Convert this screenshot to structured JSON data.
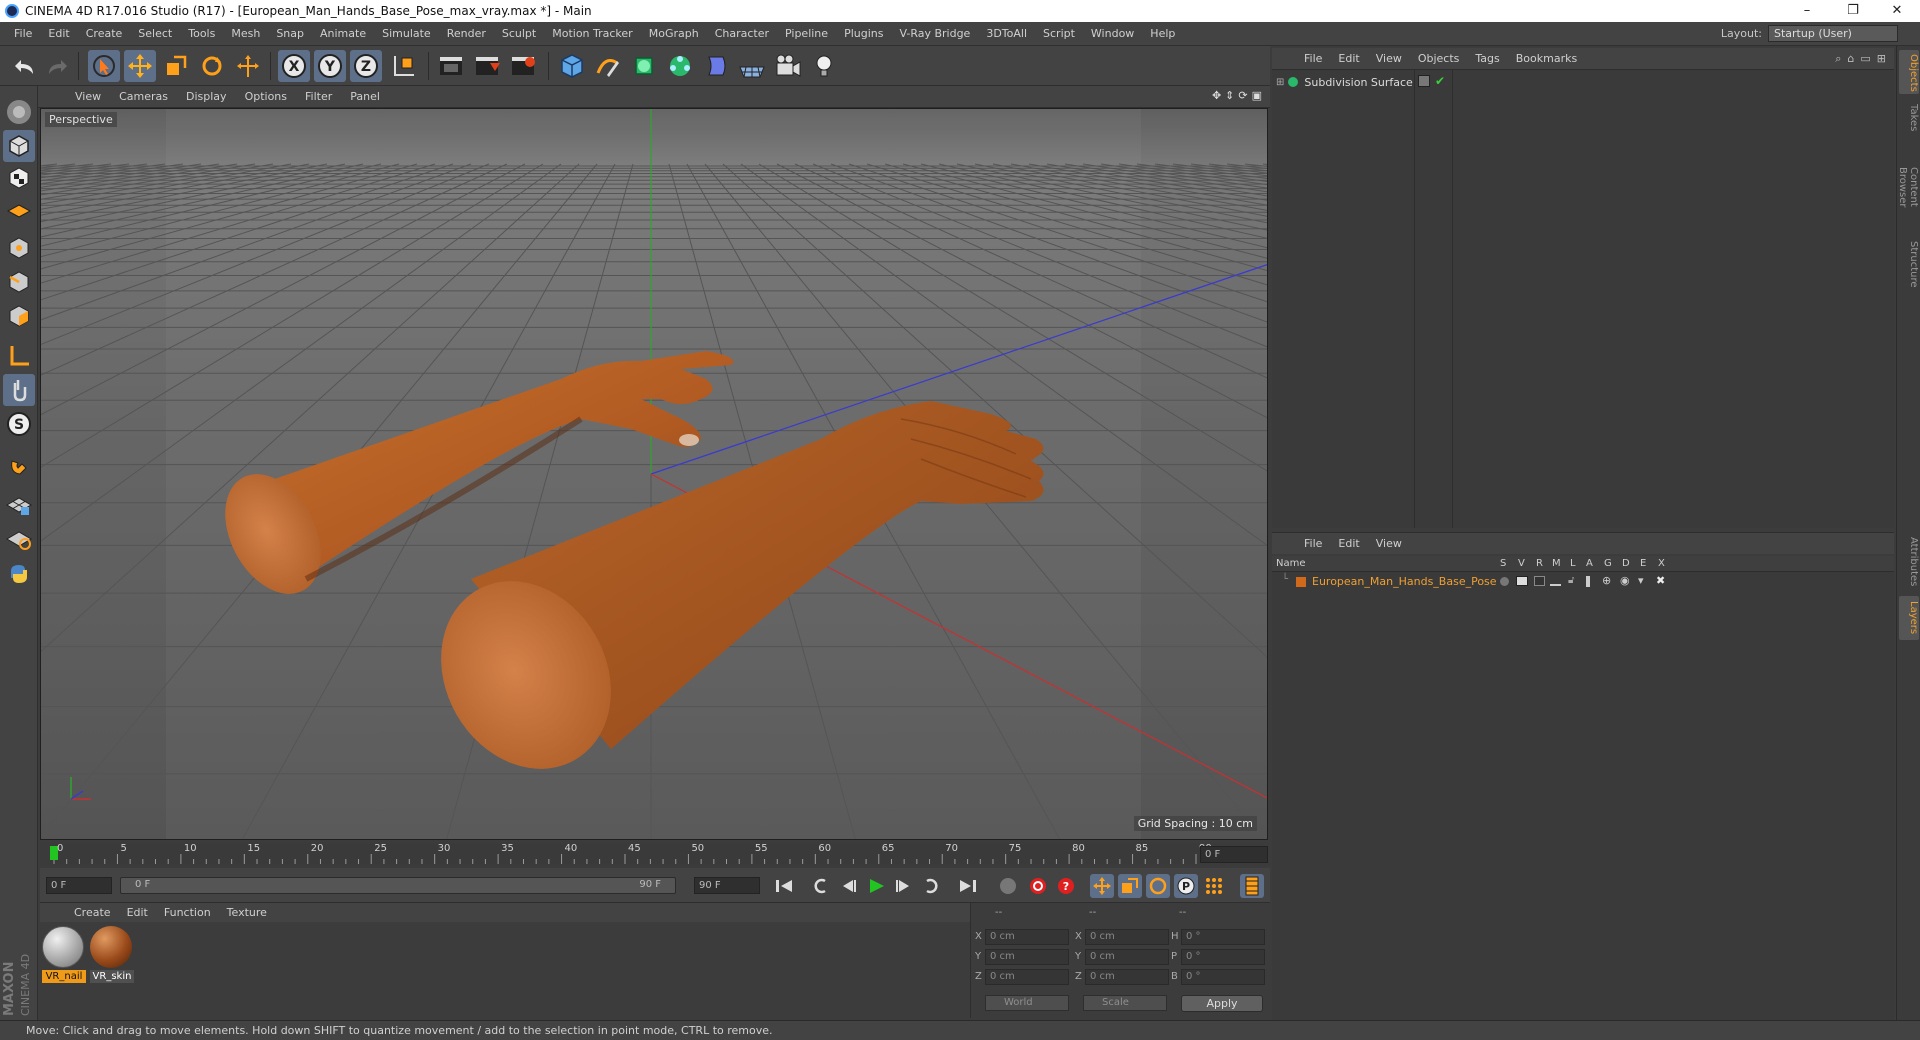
{
  "window": {
    "title": "CINEMA 4D R17.016 Studio (R17) - [European_Man_Hands_Base_Pose_max_vray.max *] - Main",
    "minimize": "–",
    "restore": "❐",
    "close": "✕"
  },
  "menubar": {
    "items": [
      "File",
      "Edit",
      "Create",
      "Select",
      "Tools",
      "Mesh",
      "Snap",
      "Animate",
      "Simulate",
      "Render",
      "Sculpt",
      "Motion Tracker",
      "MoGraph",
      "Character",
      "Pipeline",
      "Plugins",
      "V-Ray Bridge",
      "3DToAll",
      "Script",
      "Window",
      "Help"
    ],
    "layout_label": "Layout:",
    "layout_value": "Startup (User)"
  },
  "viewport": {
    "menu": [
      "View",
      "Cameras",
      "Display",
      "Options",
      "Filter",
      "Panel"
    ],
    "camera_label": "Perspective",
    "grid_spacing": "Grid Spacing : 10 cm"
  },
  "timeline": {
    "ticks": [
      "0",
      "5",
      "10",
      "15",
      "20",
      "25",
      "30",
      "35",
      "40",
      "45",
      "50",
      "55",
      "60",
      "65",
      "70",
      "75",
      "80",
      "85",
      "90"
    ],
    "current_frame": "0 F",
    "start_frame": "0 F",
    "range_start": "0 F",
    "range_end": "90 F",
    "end_frame": "90 F"
  },
  "materials": {
    "menu": [
      "Create",
      "Edit",
      "Function",
      "Texture"
    ],
    "items": [
      {
        "name": "VR_nail"
      },
      {
        "name": "VR_skin"
      }
    ]
  },
  "coords": {
    "header": [
      "--",
      "--",
      "--"
    ],
    "rows": [
      {
        "l1": "X",
        "v1": "0 cm",
        "l2": "X",
        "v2": "0 cm",
        "l3": "H",
        "v3": "0 °"
      },
      {
        "l1": "Y",
        "v1": "0 cm",
        "l2": "Y",
        "v2": "0 cm",
        "l3": "P",
        "v3": "0 °"
      },
      {
        "l1": "Z",
        "v1": "0 cm",
        "l2": "Z",
        "v2": "0 cm",
        "l3": "B",
        "v3": "0 °"
      }
    ],
    "space": "World",
    "mode": "Scale",
    "apply": "Apply"
  },
  "objects": {
    "menu": [
      "File",
      "Edit",
      "View",
      "Objects",
      "Tags",
      "Bookmarks"
    ],
    "items": [
      {
        "name": "Subdivision Surface"
      }
    ]
  },
  "layers": {
    "menu": [
      "File",
      "Edit",
      "View"
    ],
    "columns": [
      "Name",
      "S",
      "V",
      "R",
      "M",
      "L",
      "A",
      "G",
      "D",
      "E",
      "X"
    ],
    "items": [
      {
        "name": "European_Man_Hands_Base_Pose",
        "color": "#d06a1a"
      }
    ]
  },
  "side_tabs": {
    "top": [
      "Objects",
      "Takes",
      "Content Browser",
      "Structure"
    ],
    "bottom": [
      "Attributes",
      "Layers"
    ]
  },
  "status": "Move: Click and drag to move elements. Hold down SHIFT to quantize movement / add to the selection in point mode, CTRL to remove.",
  "brand": {
    "line1": "MAXON",
    "line2": "CINEMA 4D"
  },
  "colors": {
    "accent": "#f0a030",
    "axis_x": "#c83030",
    "axis_y": "#2fa52f",
    "axis_z": "#3a3ad0",
    "skin": "#b8622a"
  }
}
